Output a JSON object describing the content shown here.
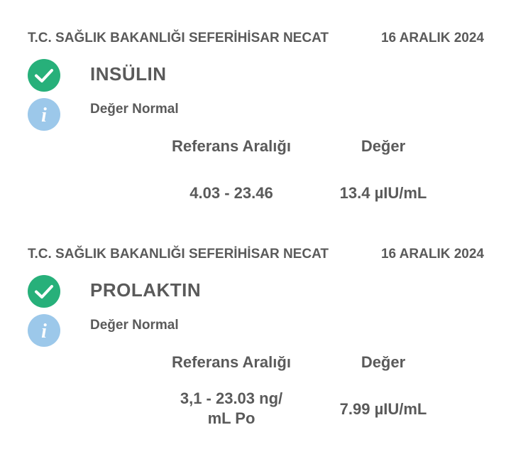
{
  "colors": {
    "check_green": "#27b07a",
    "info_blue": "#9cc8ea",
    "text": "#5a5a5a"
  },
  "results": [
    {
      "hospital": "T.C. SAĞLIK BAKANLIĞI SEFERİHİSAR NECAT",
      "date": "16 ARALIK 2024",
      "test_name": "INSÜLIN",
      "status": "Değer Normal",
      "ref_header": "Referans Aralığı",
      "value_header": "Değer",
      "ref_range": "4.03 - 23.46",
      "value": "13.4 µIU/mL",
      "check_icon": "check-circle-icon",
      "info_icon": "info-circle-icon"
    },
    {
      "hospital": "T.C. SAĞLIK BAKANLIĞI SEFERİHİSAR NECAT",
      "date": "16 ARALIK 2024",
      "test_name": "PROLAKTIN",
      "status": "Değer Normal",
      "ref_header": "Referans Aralığı",
      "value_header": "Değer",
      "ref_range_line1": "3,1 - 23.03 ng/",
      "ref_range_line2": "mL Po",
      "value": "7.99 µIU/mL",
      "check_icon": "check-circle-icon",
      "info_icon": "info-circle-icon"
    }
  ]
}
